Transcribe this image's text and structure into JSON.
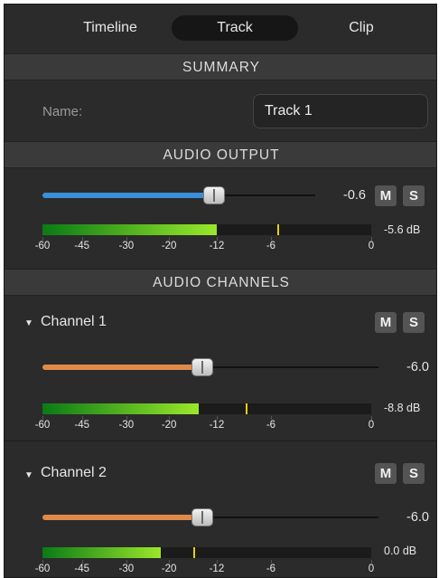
{
  "tabs": [
    {
      "label": "Timeline",
      "active": false
    },
    {
      "label": "Track",
      "active": true
    },
    {
      "label": "Clip",
      "active": false
    }
  ],
  "summary": {
    "header": "SUMMARY",
    "name_label": "Name:",
    "name_value": "Track 1"
  },
  "audio_output": {
    "header": "AUDIO OUTPUT",
    "volume_text": "-0.6",
    "volume_value": -0.6,
    "mute_label": "M",
    "solo_label": "S",
    "meter_db_text": "-5.6 dB",
    "meter_level_db": -12,
    "meter_peak_db": -5.6
  },
  "meter_scale": [
    "-60",
    "-45",
    "-30",
    "-20",
    "-12",
    "-6",
    "0"
  ],
  "audio_channels": {
    "header": "AUDIO CHANNELS",
    "channels": [
      {
        "name": "Channel 1",
        "mute_label": "M",
        "solo_label": "S",
        "volume_text": "-6.0",
        "volume_value": -6.0,
        "meter_db_text": "-8.8 dB",
        "meter_level_db": -15,
        "meter_peak_db": -8.8
      },
      {
        "name": "Channel 2",
        "mute_label": "M",
        "solo_label": "S",
        "volume_text": "-6.0",
        "volume_value": -6.0,
        "meter_db_text": "0.0 dB",
        "meter_level_db": -22,
        "meter_peak_db": -16
      }
    ]
  },
  "colors": {
    "output_slider": "#3a8fd6",
    "channel_slider": "#e08a4a",
    "meter_green_dark": "#0a7a16",
    "meter_green_light": "#9ae82a",
    "peak": "#e6d200"
  }
}
